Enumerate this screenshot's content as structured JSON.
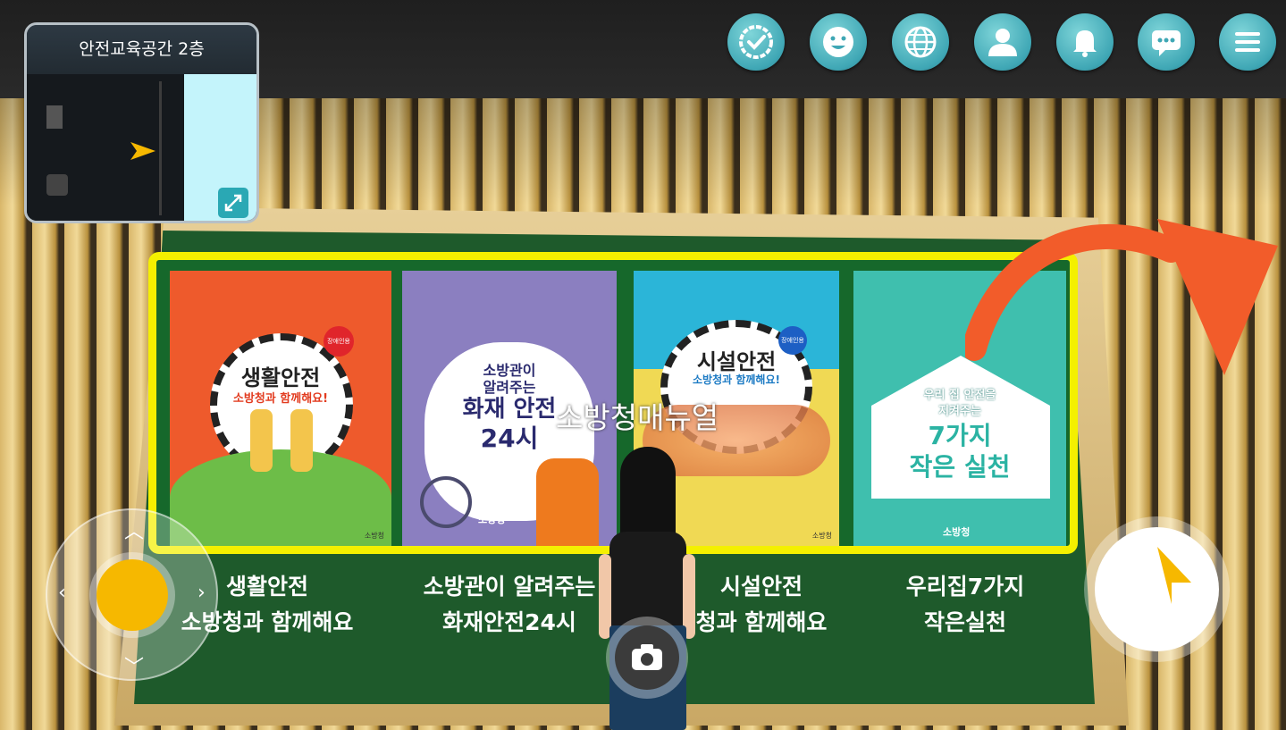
{
  "minimap": {
    "title": "안전교육공간 2층",
    "expand_icon": "expand-diagonal-icon",
    "player_marker_color": "#f6b800"
  },
  "top_menu": {
    "buttons": [
      {
        "name": "check-badge-icon"
      },
      {
        "name": "smile-emoji-icon"
      },
      {
        "name": "globe-icon"
      },
      {
        "name": "profile-icon"
      },
      {
        "name": "bell-icon"
      },
      {
        "name": "chat-bubble-icon"
      },
      {
        "name": "hamburger-menu-icon"
      }
    ],
    "accent_color": "#4fb6c2"
  },
  "posters": [
    {
      "title": "생활안전",
      "subtitle": "소방청과 함께해요!",
      "badge": "장애인용",
      "publisher": "소방청",
      "bg": "#ee5a2c"
    },
    {
      "title_line1": "소방관이",
      "title_line2": "알려주는",
      "title_main": "화재 안전",
      "title_main2": "24시",
      "publisher": "소방청",
      "bg": "#8b7fc0"
    },
    {
      "title": "시설안전",
      "subtitle": "소방청과 함께해요!",
      "badge": "장애인용",
      "publisher": "소방청",
      "bg": "#f0d954"
    },
    {
      "title_line1": "우리 집 안전을",
      "title_line2": "지켜주는",
      "title_main": "7가지",
      "title_main2": "작은 실천",
      "publisher": "소방청",
      "bg": "#3fbfae"
    }
  ],
  "overlay_label": "소방청매뉴얼",
  "captions": [
    {
      "line1": "생활안전",
      "line2": "소방청과 함께해요"
    },
    {
      "line1": "소방관이 알려주는",
      "line2": "화재안전24시"
    },
    {
      "line1": "시설안전",
      "line2": "청과 함께해요"
    },
    {
      "line1": "우리집7가지",
      "line2": "작은실천"
    }
  ],
  "controls": {
    "joystick_color": "#f6b800",
    "camera_icon": "camera-icon",
    "jump_icon": "curved-up-arrow-icon"
  }
}
